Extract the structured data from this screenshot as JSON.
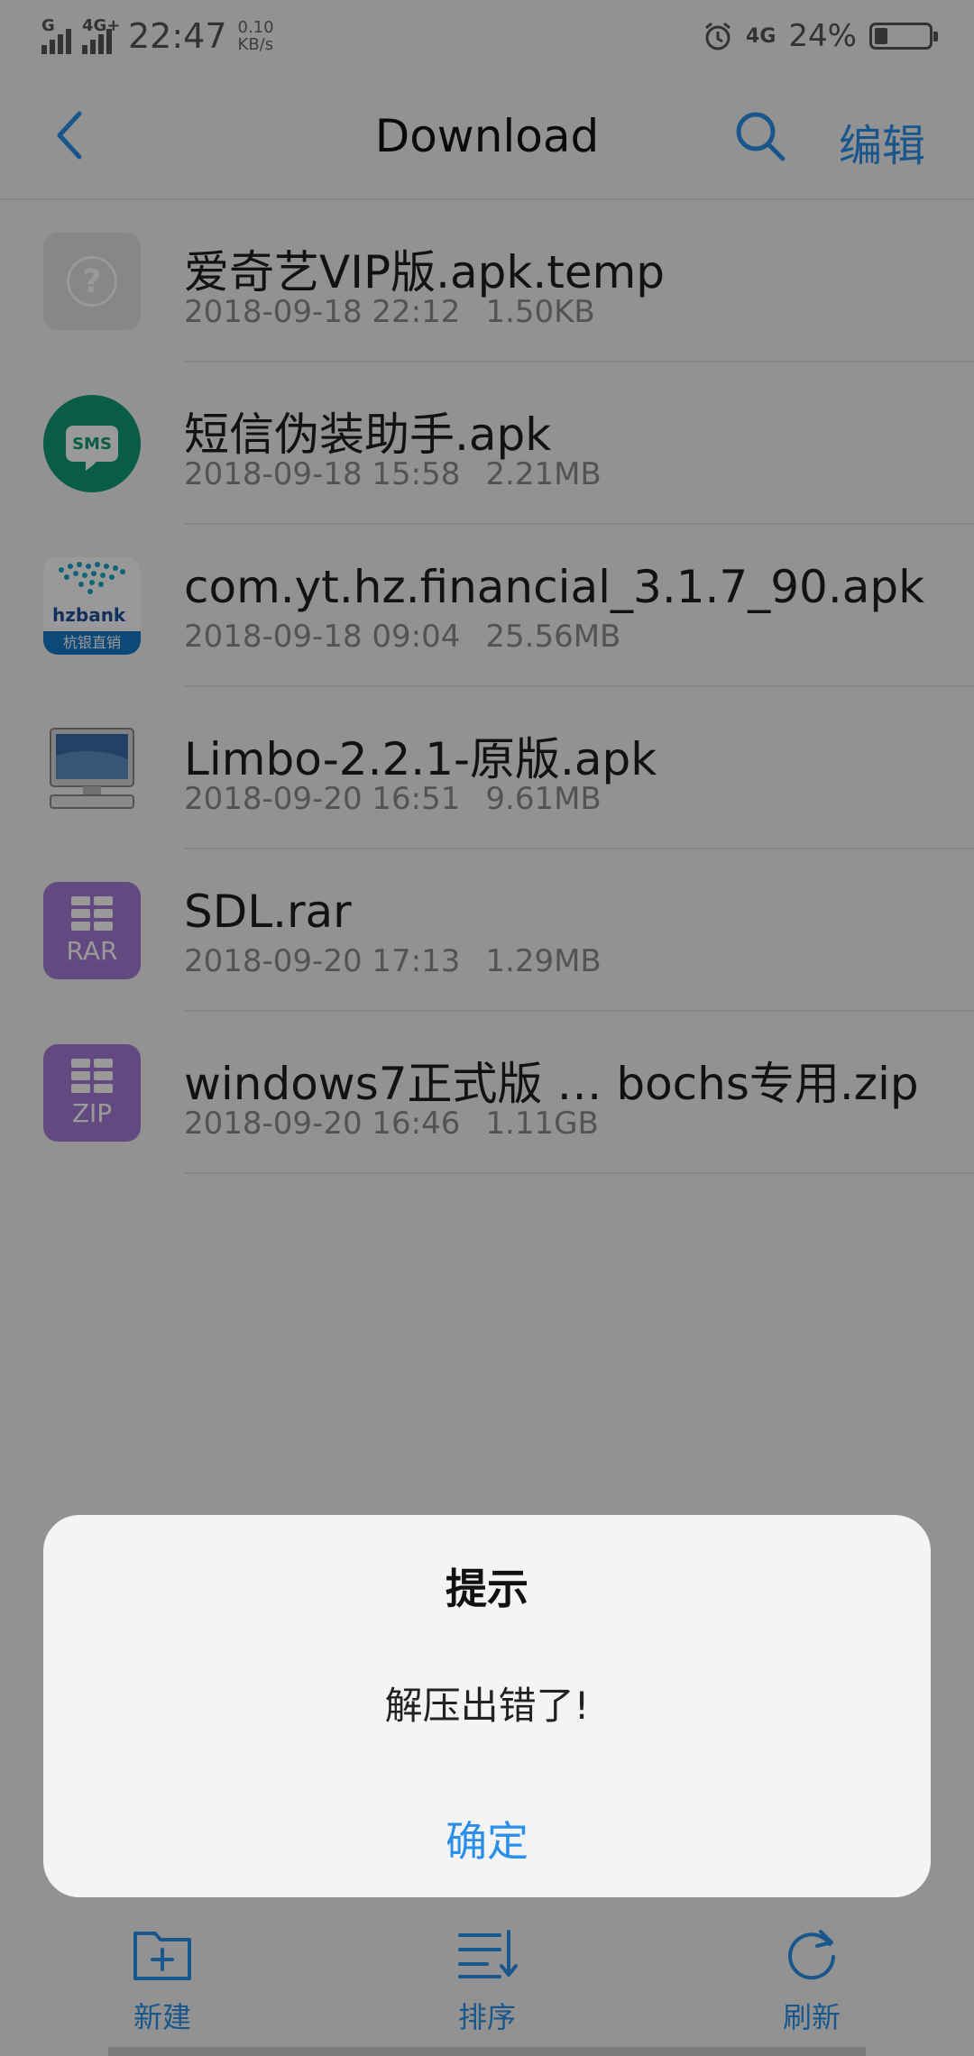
{
  "status_bar": {
    "signal_left_label": "G",
    "signal_right_label": "4G+",
    "time": "22:47",
    "speed_value": "0.10",
    "speed_unit": "KB/s",
    "network": "4G",
    "battery": "24%",
    "battery_level": 0.24
  },
  "header": {
    "title": "Download",
    "edit_label": "编辑"
  },
  "files": [
    {
      "name": "爱奇艺VIP版.apk.temp",
      "date": "2018-09-18 22:12",
      "size": "1.50KB",
      "icon": "unknown-file-icon"
    },
    {
      "name": "短信伪装助手.apk",
      "date": "2018-09-18 15:58",
      "size": "2.21MB",
      "icon": "sms-app-icon"
    },
    {
      "name": "com.yt.hz.financial_3.1.7_90.apk",
      "date": "2018-09-18 09:04",
      "size": "25.56MB",
      "icon": "hzbank-app-icon"
    },
    {
      "name": "Limbo-2.2.1-原版.apk",
      "date": "2018-09-20 16:51",
      "size": "9.61MB",
      "icon": "computer-app-icon"
    },
    {
      "name": "SDL.rar",
      "date": "2018-09-20 17:13",
      "size": "1.29MB",
      "icon": "rar-archive-icon"
    },
    {
      "name": "windows7正式版 … bochs专用.zip",
      "date": "2018-09-20 16:46",
      "size": "1.11GB",
      "icon": "zip-archive-icon"
    }
  ],
  "icons_text": {
    "sms": "SMS",
    "hz_brand": "hzbank",
    "hz_caption": "杭银直销",
    "rar": "RAR",
    "zip": "ZIP"
  },
  "dialog": {
    "title": "提示",
    "message": "解压出错了!",
    "ok_label": "确定"
  },
  "bottom_bar": {
    "new_label": "新建",
    "sort_label": "排序",
    "refresh_label": "刷新"
  },
  "colors": {
    "accent": "#2a8fe8",
    "overlay": "rgba(0,0,0,0.40)"
  }
}
